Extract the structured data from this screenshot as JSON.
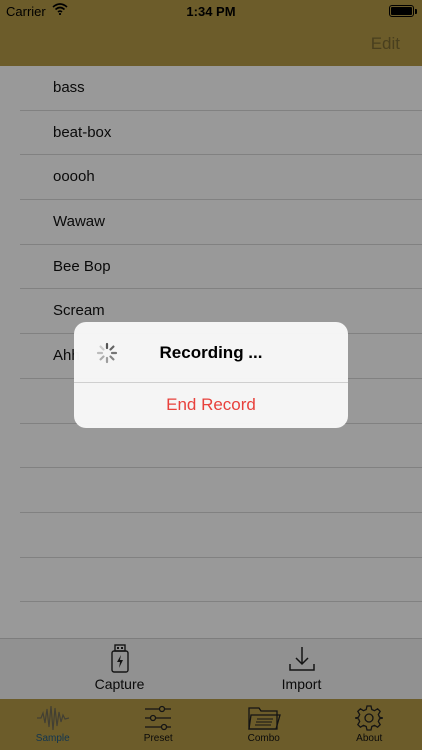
{
  "status_bar": {
    "carrier": "Carrier",
    "time": "1:34 PM",
    "battery_level": 1.0
  },
  "nav_bar": {
    "edit_label": "Edit"
  },
  "samples": [
    {
      "name": "bass"
    },
    {
      "name": "beat-box"
    },
    {
      "name": "ooooh"
    },
    {
      "name": "Wawaw"
    },
    {
      "name": "Bee Bop"
    },
    {
      "name": "Scream"
    },
    {
      "name": "Ahh"
    },
    {
      "name": ""
    },
    {
      "name": ""
    },
    {
      "name": ""
    },
    {
      "name": ""
    },
    {
      "name": ""
    },
    {
      "name": ""
    }
  ],
  "action_bar": {
    "capture": {
      "label": "Capture",
      "icon": "usb-drive-icon"
    },
    "import": {
      "label": "Import",
      "icon": "download-icon"
    }
  },
  "tab_bar": {
    "tabs": [
      {
        "label": "Sample",
        "icon": "waveform-icon",
        "active": true
      },
      {
        "label": "Preset",
        "icon": "sliders-icon",
        "active": false
      },
      {
        "label": "Combo",
        "icon": "folder-icon",
        "active": false
      },
      {
        "label": "About",
        "icon": "gear-icon",
        "active": false
      }
    ]
  },
  "alert": {
    "title": "Recording ...",
    "button_label": "End Record",
    "button_color": "#e8413c"
  },
  "colors": {
    "bar_gold": "#b59a46",
    "active_tab": "#1e5a86"
  }
}
